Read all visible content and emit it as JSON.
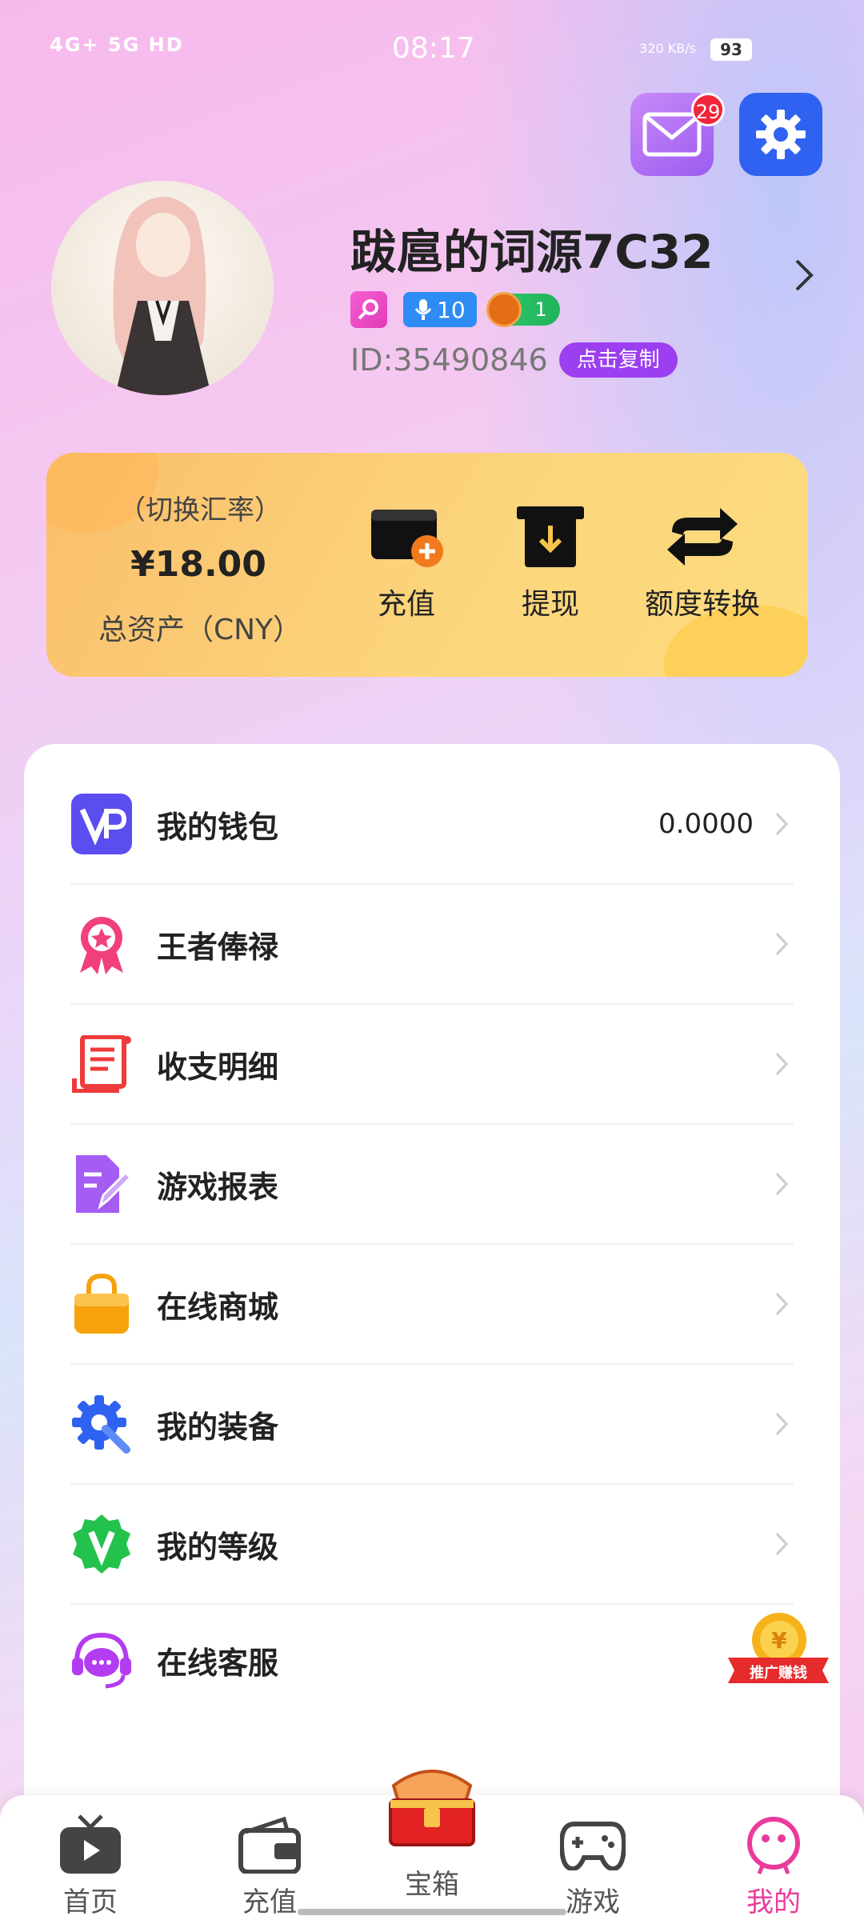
{
  "status_bar": {
    "network": "4G+ 5G HD",
    "time": "08:17",
    "speed": "320 KB/s",
    "battery": "93"
  },
  "header": {
    "message_badge": "29"
  },
  "profile": {
    "username": "跋扈的词源7C32",
    "mic_level": "10",
    "coin_count": "1",
    "id_text": "ID:35490846",
    "copy_label": "点击复制"
  },
  "assets": {
    "rate_label": "（切换汇率）",
    "amount": "¥18.00",
    "amount_label": "总资产（CNY）",
    "actions": [
      {
        "label": "充值",
        "icon": "wallet-plus-icon"
      },
      {
        "label": "提现",
        "icon": "withdraw-icon"
      },
      {
        "label": "额度转换",
        "icon": "transfer-icon"
      }
    ]
  },
  "menu": {
    "items": [
      {
        "label": "我的钱包",
        "value": "0.0000",
        "icon": "wallet-vp-icon",
        "color": "#5a4ef0"
      },
      {
        "label": "王者俸禄",
        "value": "",
        "icon": "award-ribbon-icon",
        "color": "#f2407a"
      },
      {
        "label": "收支明细",
        "value": "",
        "icon": "scroll-document-icon",
        "color": "#ef3b3b"
      },
      {
        "label": "游戏报表",
        "value": "",
        "icon": "report-edit-icon",
        "color": "#a45cf2"
      },
      {
        "label": "在线商城",
        "value": "",
        "icon": "shopping-bag-icon",
        "color": "#f7a20c"
      },
      {
        "label": "我的装备",
        "value": "",
        "icon": "gear-wrench-icon",
        "color": "#2f62f0"
      },
      {
        "label": "我的等级",
        "value": "",
        "icon": "vip-badge-icon",
        "color": "#22c24d"
      },
      {
        "label": "在线客服",
        "value": "",
        "icon": "headset-chat-icon",
        "color": "#b33cf0"
      }
    ]
  },
  "promo": {
    "label": "推广赚钱"
  },
  "bottom_nav": {
    "items": [
      {
        "label": "首页",
        "icon": "tv-icon"
      },
      {
        "label": "充值",
        "icon": "wallet-icon"
      },
      {
        "label": "宝箱",
        "icon": "treasure-chest-icon"
      },
      {
        "label": "游戏",
        "icon": "gamepad-icon"
      },
      {
        "label": "我的",
        "icon": "smiley-face-icon",
        "active": true
      }
    ]
  },
  "colors": {
    "accent_pink": "#ea3a9c",
    "copy_purple": "#9c3ff0",
    "settings_blue": "#2f62f0"
  }
}
